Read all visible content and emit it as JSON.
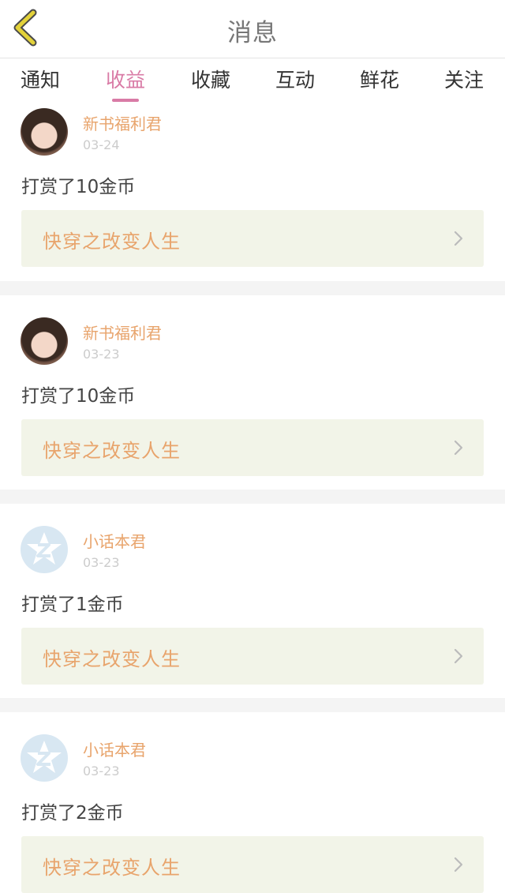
{
  "header": {
    "title": "消息",
    "back_icon": "chevron-left-icon"
  },
  "tabs": [
    {
      "label": "通知",
      "active": false
    },
    {
      "label": "收益",
      "active": true
    },
    {
      "label": "收藏",
      "active": false
    },
    {
      "label": "互动",
      "active": false
    },
    {
      "label": "鲜花",
      "active": false
    },
    {
      "label": "关注",
      "active": false
    }
  ],
  "colors": {
    "accent": "#d97ba6",
    "name": "#e8a46c",
    "back_icon": "#e3d23a",
    "book_bg": "#f2f4e8"
  },
  "messages": [
    {
      "user": "新书福利君",
      "date": "03-24",
      "text": "打赏了10金币",
      "book": "快穿之改变人生",
      "avatar": "photo"
    },
    {
      "user": "新书福利君",
      "date": "03-23",
      "text": "打赏了10金币",
      "book": "快穿之改变人生",
      "avatar": "photo"
    },
    {
      "user": "小话本君",
      "date": "03-23",
      "text": "打赏了1金币",
      "book": "快穿之改变人生",
      "avatar": "default"
    },
    {
      "user": "小话本君",
      "date": "03-23",
      "text": "打赏了2金币",
      "book": "快穿之改变人生",
      "avatar": "default"
    }
  ]
}
